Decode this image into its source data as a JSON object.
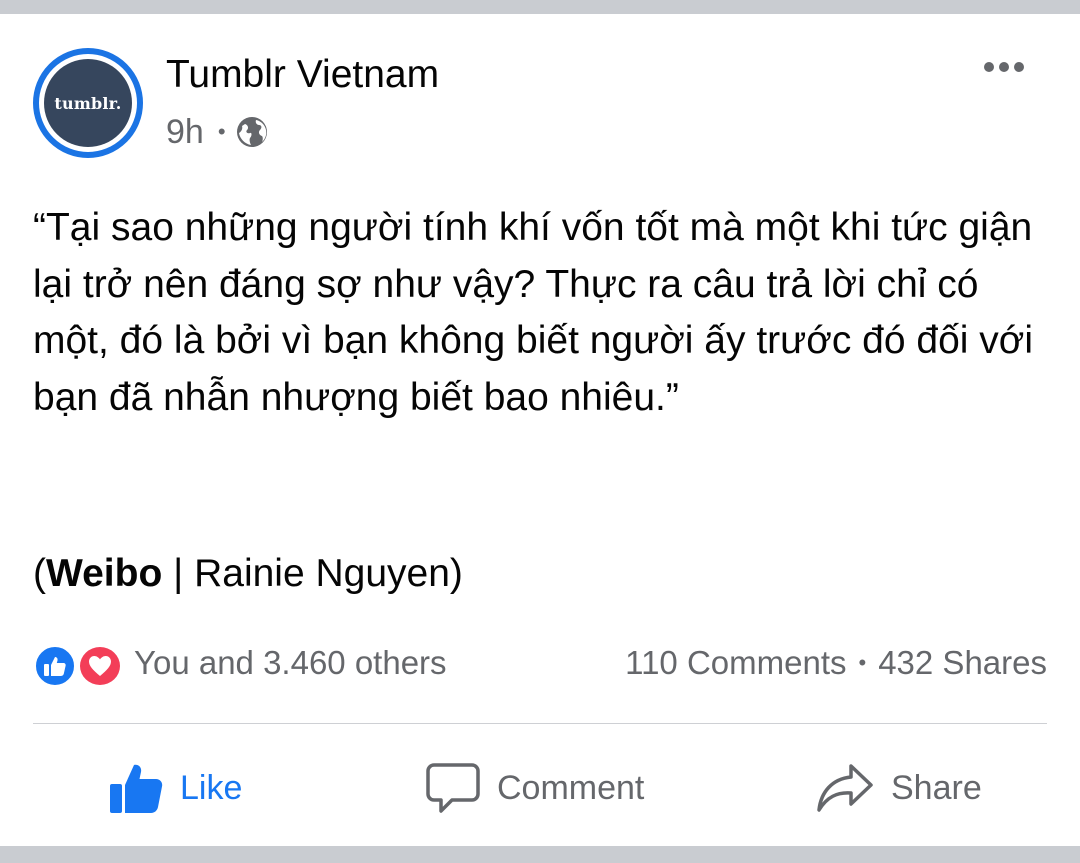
{
  "post": {
    "page_name": "Tumblr Vietnam",
    "avatar_text": "tumblr.",
    "time": "9h",
    "meta_separator": "•",
    "privacy_icon": "globe-icon",
    "body": "“Tại sao những người tính khí vốn tốt mà một khi tức giận lại trở nên đáng sợ như vậy? Thực ra câu trả lời chỉ có một, đó là bởi vì bạn không biết người ấy trước đó đối với bạn đã nhẫn nhượng biết bao nhiêu.”",
    "source_open": "(",
    "source_bold": "Weibo",
    "source_rest": " | Rainie Nguyen)"
  },
  "reactions": {
    "icons": [
      "like-icon",
      "love-icon"
    ],
    "count_text": "You and 3.460 others",
    "comments": "110 Comments",
    "separator": "•",
    "shares": "432 Shares"
  },
  "actions": {
    "like_label": "Like",
    "comment_label": "Comment",
    "share_label": "Share"
  },
  "colors": {
    "brand_blue": "#1877f2",
    "love_red": "#f33e58",
    "tumblr_navy": "#36465d",
    "secondary_text": "#65676b",
    "band_gray": "#c9ccd1"
  }
}
